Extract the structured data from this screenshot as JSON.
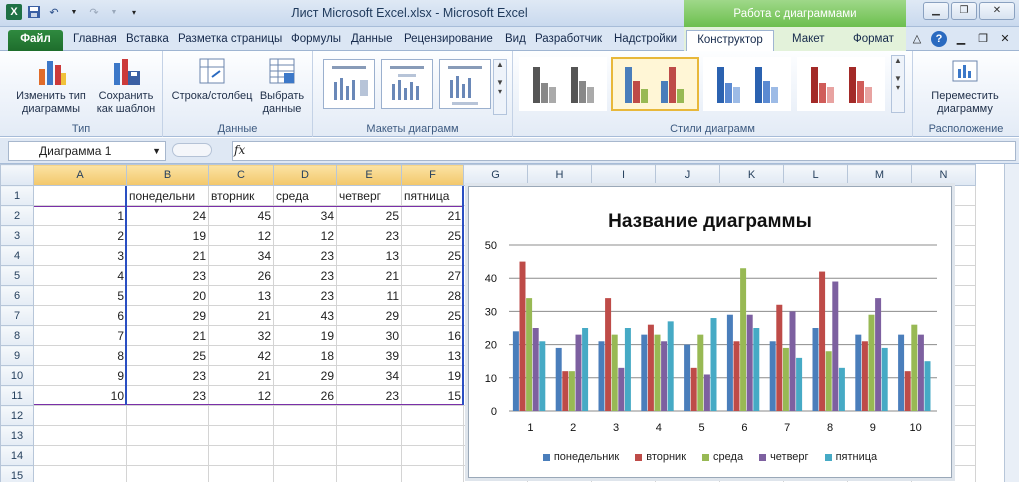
{
  "window": {
    "title": "Лист Microsoft Excel.xlsx  -  Microsoft Excel",
    "context_tab_group": "Работа с диаграммами"
  },
  "tabs": [
    "Файл",
    "Главная",
    "Вставка",
    "Разметка страницы",
    "Формулы",
    "Данные",
    "Рецензирование",
    "Вид",
    "Разработчик",
    "Надстройки",
    "Конструктор",
    "Макет",
    "Формат"
  ],
  "active_tab": "Конструктор",
  "ribbon": {
    "change_type": "Изменить тип диаграммы",
    "change_type_l1": "Изменить тип",
    "change_type_l2": "диаграммы",
    "save_template_l1": "Сохранить",
    "save_template_l2": "как шаблон",
    "group_type": "Тип",
    "switch_row_col": "Строка/столбец",
    "select_data_l1": "Выбрать",
    "select_data_l2": "данные",
    "group_data": "Данные",
    "group_layouts": "Макеты диаграмм",
    "group_styles": "Стили диаграмм",
    "move_chart_l1": "Переместить",
    "move_chart_l2": "диаграмму",
    "group_location": "Расположение"
  },
  "formula_bar": {
    "name_box": "Диаграмма 1",
    "fx": "fx",
    "value": ""
  },
  "columns": [
    "A",
    "B",
    "C",
    "D",
    "E",
    "F",
    "G",
    "H",
    "I",
    "J",
    "K",
    "L",
    "M",
    "N"
  ],
  "rows": [
    [
      "",
      "понедельник",
      "вторник",
      "среда",
      "четверг",
      "пятница"
    ],
    [
      "1",
      "24",
      "45",
      "34",
      "25",
      "21"
    ],
    [
      "2",
      "19",
      "12",
      "12",
      "23",
      "25"
    ],
    [
      "3",
      "21",
      "34",
      "23",
      "13",
      "25"
    ],
    [
      "4",
      "23",
      "26",
      "23",
      "21",
      "27"
    ],
    [
      "5",
      "20",
      "13",
      "23",
      "11",
      "28"
    ],
    [
      "6",
      "29",
      "21",
      "43",
      "29",
      "25"
    ],
    [
      "7",
      "21",
      "32",
      "19",
      "30",
      "16"
    ],
    [
      "8",
      "25",
      "42",
      "18",
      "39",
      "13"
    ],
    [
      "9",
      "23",
      "21",
      "29",
      "34",
      "19"
    ],
    [
      "10",
      "23",
      "12",
      "26",
      "23",
      "15"
    ],
    [
      "",
      "",
      "",
      "",
      "",
      ""
    ],
    [
      "",
      "",
      "",
      "",
      "",
      ""
    ],
    [
      "",
      "",
      "",
      "",
      "",
      ""
    ],
    [
      "",
      "",
      "",
      "",
      "",
      ""
    ]
  ],
  "header_row_display": [
    "",
    "понедельни",
    "вторник",
    "среда",
    "четверг",
    "пятница"
  ],
  "chart_data": {
    "type": "bar",
    "title": "Название диаграммы",
    "categories": [
      "1",
      "2",
      "3",
      "4",
      "5",
      "6",
      "7",
      "8",
      "9",
      "10"
    ],
    "ylim": [
      0,
      50
    ],
    "yticks": [
      0,
      10,
      20,
      30,
      40,
      50
    ],
    "grid": true,
    "legend": "bottom",
    "series": [
      {
        "name": "понедельник",
        "color": "#4a7ebb",
        "values": [
          24,
          19,
          21,
          23,
          20,
          29,
          21,
          25,
          23,
          23
        ]
      },
      {
        "name": "вторник",
        "color": "#be4b48",
        "values": [
          45,
          12,
          34,
          26,
          13,
          21,
          32,
          42,
          21,
          12
        ]
      },
      {
        "name": "среда",
        "color": "#98b954",
        "values": [
          34,
          12,
          23,
          23,
          23,
          43,
          19,
          18,
          29,
          26
        ]
      },
      {
        "name": "четверг",
        "color": "#7d60a0",
        "values": [
          25,
          23,
          13,
          21,
          11,
          29,
          30,
          39,
          34,
          23
        ]
      },
      {
        "name": "пятница",
        "color": "#46aac5",
        "values": [
          21,
          25,
          25,
          27,
          28,
          25,
          16,
          13,
          19,
          15
        ]
      }
    ]
  }
}
